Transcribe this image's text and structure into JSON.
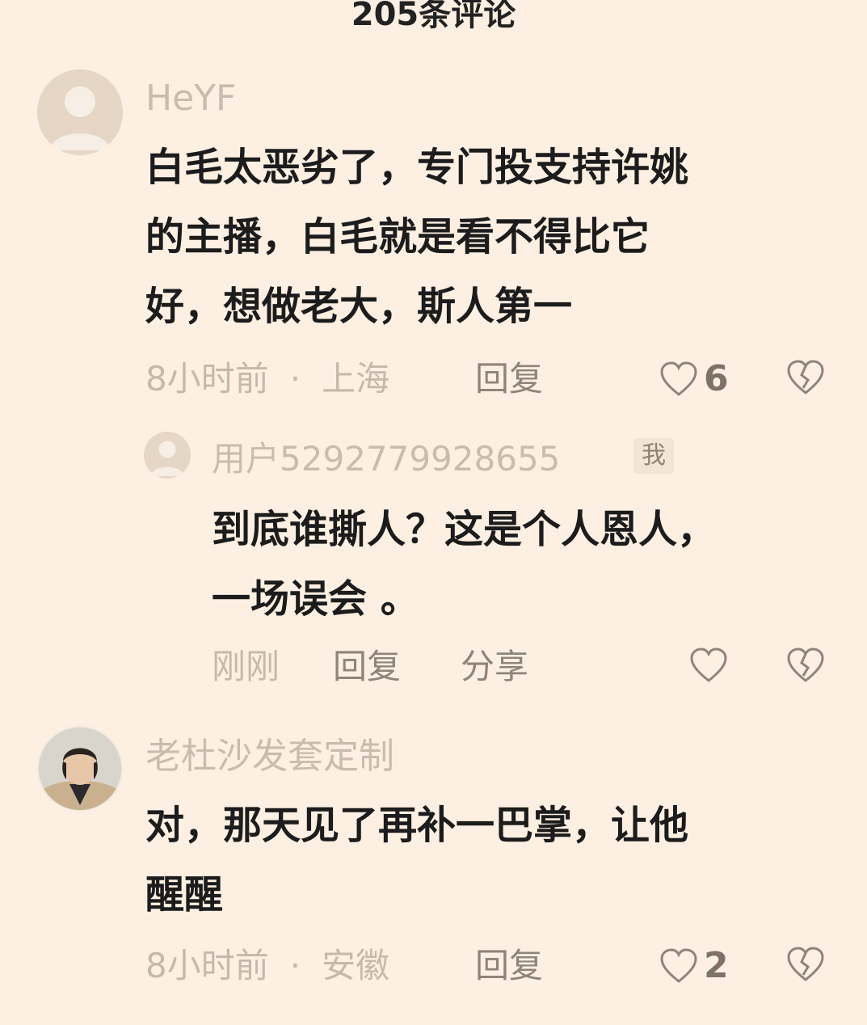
{
  "header": {
    "title": "205条评论"
  },
  "comments": [
    {
      "username": "HeYF",
      "text_lines": [
        "白毛太恶劣了，专门投支持许姚",
        "的主播，白毛就是看不得比它",
        "好，想做老大，斯人第一"
      ],
      "time": "8小时前",
      "dot": "·",
      "location": "上海",
      "reply_label": "回复",
      "likes": "6",
      "replies": [
        {
          "username": "用户5292779928655",
          "badge": "我",
          "text_lines": [
            "到底谁撕人？这是个人恩人，",
            "一场误会 。"
          ],
          "time": "刚刚",
          "reply_label": "回复",
          "share_label": "分享"
        }
      ]
    },
    {
      "username": "老杜沙发套定制",
      "text_lines": [
        "对，那天见了再补一巴掌，让他",
        "醒醒"
      ],
      "time": "8小时前",
      "dot": "·",
      "location": "安徽",
      "reply_label": "回复",
      "likes": "2"
    }
  ],
  "icons": {
    "like": "heart-outline-icon",
    "dislike": "broken-heart-icon",
    "avatar_default": "default-avatar-icon"
  },
  "colors": {
    "background": "#fdf0e3",
    "muted": "#c6b9ab",
    "action": "#8f8479"
  }
}
